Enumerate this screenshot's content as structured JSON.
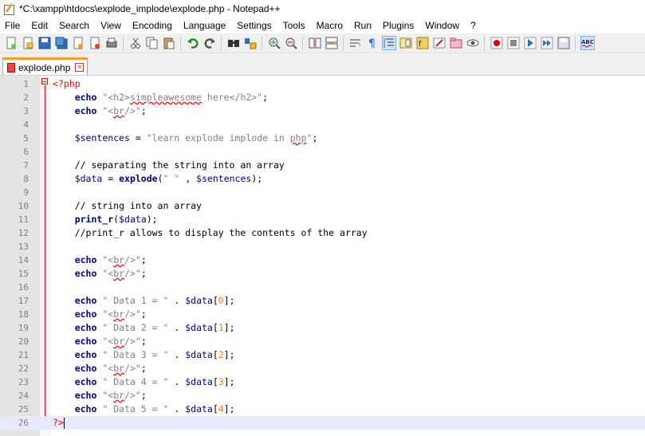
{
  "window": {
    "title": "*C:\\xampp\\htdocs\\explode_implode\\explode.php - Notepad++"
  },
  "menu": [
    "File",
    "Edit",
    "Search",
    "View",
    "Encoding",
    "Language",
    "Settings",
    "Tools",
    "Macro",
    "Run",
    "Plugins",
    "Window",
    "?"
  ],
  "tab": {
    "label": "explode.php"
  },
  "lines": [
    {
      "n": "1",
      "c": "<?php"
    },
    {
      "n": "2",
      "c": "echo \"<h2>simpleawesome here</h2>\";"
    },
    {
      "n": "3",
      "c": "echo \"<br/>\";"
    },
    {
      "n": "4",
      "c": ""
    },
    {
      "n": "5",
      "c": "$sentences = \"learn explode implode in php\";"
    },
    {
      "n": "6",
      "c": ""
    },
    {
      "n": "7",
      "c": "// separating the string into an array"
    },
    {
      "n": "8",
      "c": "$data = explode(\" \" , $sentences);"
    },
    {
      "n": "9",
      "c": ""
    },
    {
      "n": "10",
      "c": "// string into an array"
    },
    {
      "n": "11",
      "c": "print_r($data);"
    },
    {
      "n": "12",
      "c": "//print_r allows to display the contents of the array"
    },
    {
      "n": "13",
      "c": ""
    },
    {
      "n": "14",
      "c": "echo \"<br/>\";"
    },
    {
      "n": "15",
      "c": "echo \"<br/>\";"
    },
    {
      "n": "16",
      "c": ""
    },
    {
      "n": "17",
      "c": "echo \" Data 1 = \" . $data[0];"
    },
    {
      "n": "18",
      "c": "echo \"<br/>\";"
    },
    {
      "n": "19",
      "c": "echo \" Data 2 = \" . $data[1];"
    },
    {
      "n": "20",
      "c": "echo \"<br/>\";"
    },
    {
      "n": "21",
      "c": "echo \" Data 3 = \" . $data[2];"
    },
    {
      "n": "22",
      "c": "echo \"<br/>\";"
    },
    {
      "n": "23",
      "c": "echo \" Data 4 = \" . $data[3];"
    },
    {
      "n": "24",
      "c": "echo \"<br/>\";"
    },
    {
      "n": "25",
      "c": "echo \" Data 5 = \" . $data[4];"
    },
    {
      "n": "26",
      "c": "?>"
    }
  ],
  "toolbar_icons": [
    "new-file-icon",
    "open-file-icon",
    "save-icon",
    "save-all-icon",
    "close-icon",
    "close-all-icon",
    "print-icon",
    "cut-icon",
    "copy-icon",
    "paste-icon",
    "undo-icon",
    "redo-icon",
    "find-icon",
    "replace-icon",
    "zoom-in-icon",
    "zoom-out-icon",
    "sync-vertical-icon",
    "sync-horizontal-icon",
    "word-wrap-icon",
    "show-all-chars-icon",
    "indent-guide-icon",
    "doc-map-icon",
    "function-list-icon",
    "folder-workspace-icon",
    "monitoring-icon",
    "record-macro-icon",
    "stop-record-icon",
    "play-macro-icon",
    "run-macro-multiple-icon",
    "save-macro-icon",
    "spell-check-icon"
  ],
  "colors": {
    "accent_tab": "#fa9b28",
    "keyword": "#000080",
    "comment": "#008000",
    "string": "#808080",
    "number": "#ff8000",
    "php_tag": "#e00000"
  }
}
